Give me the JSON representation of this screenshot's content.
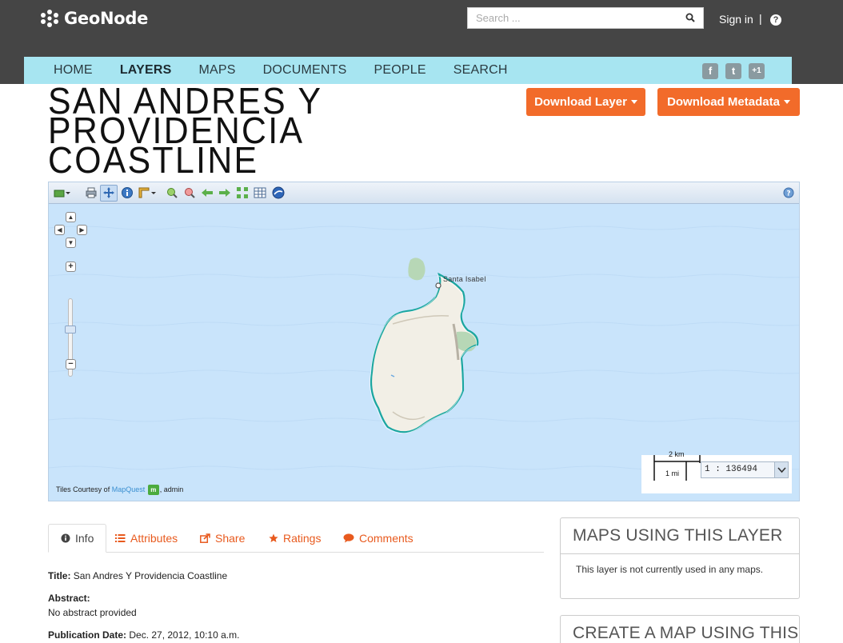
{
  "header": {
    "logo_text": "GeoNode",
    "search_placeholder": "Search ...",
    "signin_label": "Sign in",
    "separator": "|",
    "help_label": "?"
  },
  "nav": {
    "items": [
      "HOME",
      "LAYERS",
      "MAPS",
      "DOCUMENTS",
      "PEOPLE",
      "SEARCH"
    ],
    "active": "LAYERS",
    "social": {
      "facebook": "f",
      "twitter": "t",
      "gplus": "+1"
    }
  },
  "layer": {
    "title_lines": [
      "SAN ANDRES Y",
      "PROVIDENCIA",
      "COASTLINE"
    ]
  },
  "actions": {
    "download_layer": "Download Layer",
    "download_metadata": "Download Metadata"
  },
  "map": {
    "place_label": "Santa Isabel",
    "attribution_prefix": "Tiles Courtesy of ",
    "attribution_link": "MapQuest",
    "attribution_badge": "m",
    "attribution_suffix": ", admin",
    "scale_mi": "1 mi",
    "scale_km": "2 km",
    "scale_value": "1 : 136494",
    "water_color": "#c9e4fb",
    "land_color": "#f2efe6",
    "outline_color": "#1aa6a0"
  },
  "tabs": {
    "info": "Info",
    "attributes": "Attributes",
    "share": "Share",
    "ratings": "Ratings",
    "comments": "Comments"
  },
  "info": {
    "title_label": "Title:",
    "title_value": "San Andres Y Providencia Coastline",
    "abstract_label": "Abstract:",
    "abstract_value": "No abstract provided",
    "pubdate_label": "Publication Date:",
    "pubdate_value": "Dec. 27, 2012, 10:10 a.m."
  },
  "sidebar": {
    "maps_title": "MAPS USING THIS LAYER",
    "maps_body": "This layer is not currently used in any maps.",
    "create_title": "CREATE A MAP USING THIS LAYER"
  },
  "colors": {
    "topbar": "#454545",
    "navbar": "#a7e5f1",
    "accent": "#f26b2a"
  }
}
